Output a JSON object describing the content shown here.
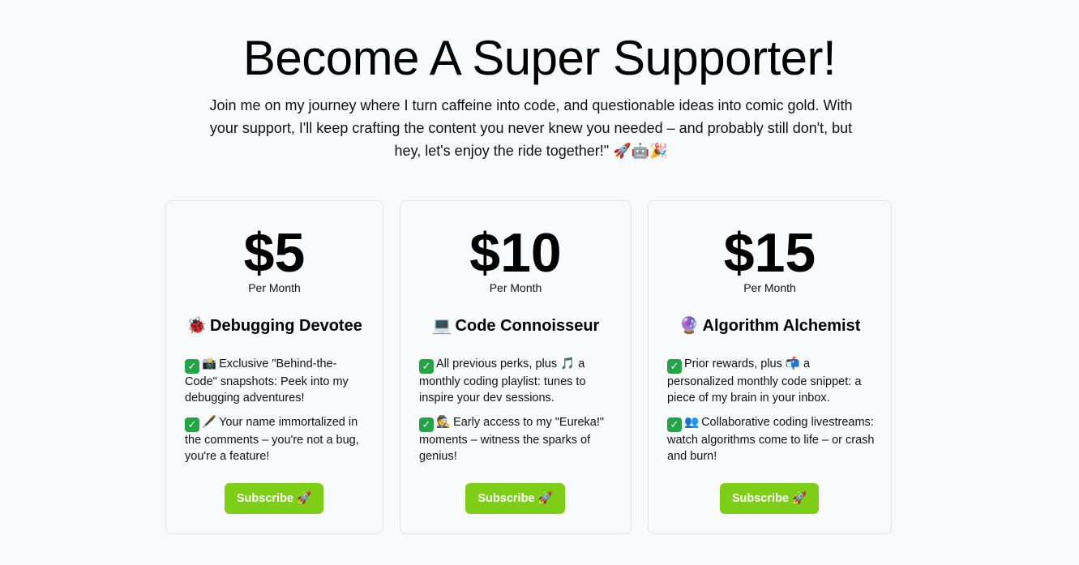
{
  "hero": {
    "title": "Become A Super Supporter!",
    "subtitle": "Join me on my journey where I turn caffeine into code, and questionable ideas into comic gold. With your support, I'll keep crafting the content you never knew you needed – and probably still don't, but hey, let's enjoy the ride together!\" 🚀🤖🎉"
  },
  "colors": {
    "background": "#f8fafc",
    "button": "#7ccf16",
    "check": "#22a447"
  },
  "tiers": [
    {
      "price": "$5",
      "period": "Per Month",
      "emoji": "🐞",
      "name": "Debugging Devotee",
      "perks": [
        {
          "icon": "📸",
          "text": "Exclusive \"Behind-the-Code\" snapshots: Peek into my debugging adventures!"
        },
        {
          "icon": "🖋️",
          "text": "Your name immortalized in the comments – you're not a bug, you're a feature!"
        }
      ],
      "button": "Subscribe 🚀"
    },
    {
      "price": "$10",
      "period": "Per Month",
      "emoji": "💻",
      "name": "Code Connoisseur",
      "perks": [
        {
          "icon": "",
          "text": "All previous perks, plus 🎵 a monthly coding playlist: tunes to inspire your dev sessions."
        },
        {
          "icon": "🕵️",
          "text": "Early access to my \"Eureka!\" moments – witness the sparks of genius!"
        }
      ],
      "button": "Subscribe 🚀"
    },
    {
      "price": "$15",
      "period": "Per Month",
      "emoji": "🔮",
      "name": "Algorithm Alchemist",
      "perks": [
        {
          "icon": "",
          "text": "Prior rewards, plus 📬 a personalized monthly code snippet: a piece of my brain in your inbox."
        },
        {
          "icon": "👥",
          "text": "Collaborative coding livestreams: watch algorithms come to life – or crash and burn!"
        }
      ],
      "button": "Subscribe 🚀"
    }
  ],
  "check_glyph": "✓"
}
